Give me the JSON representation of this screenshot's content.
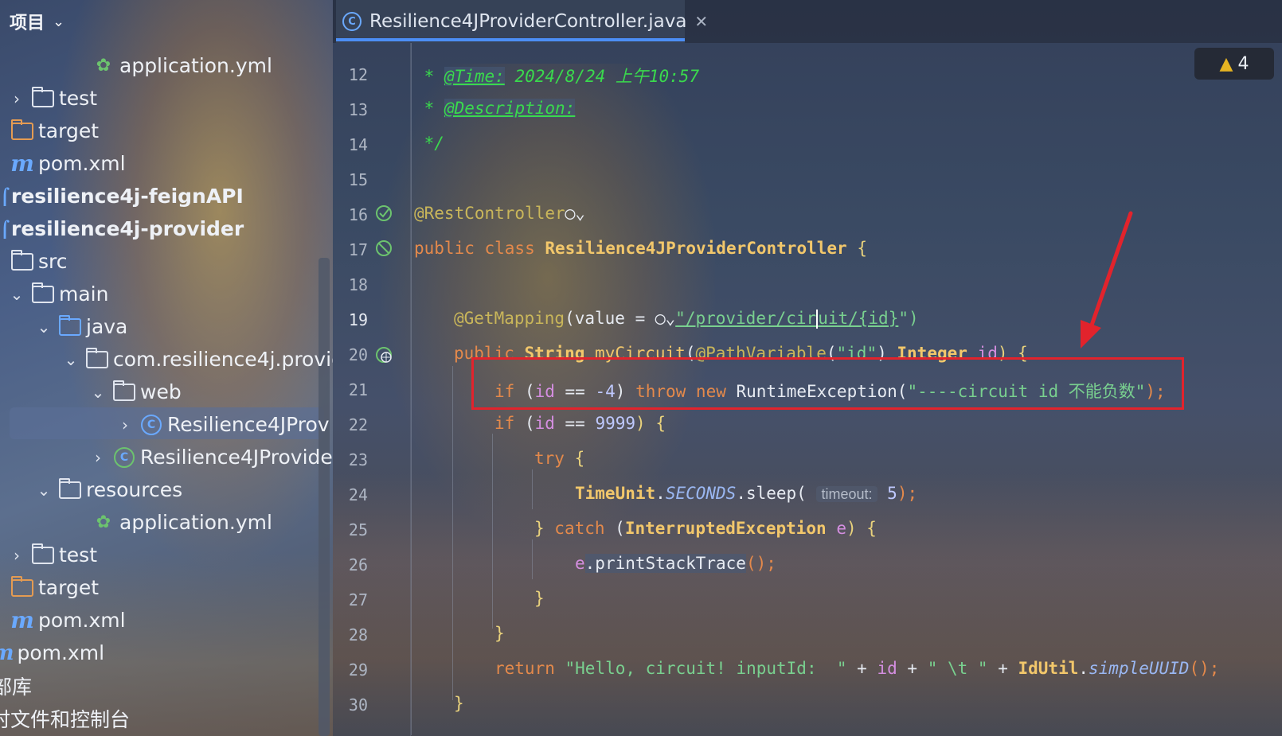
{
  "sidebar": {
    "title": "项目",
    "items": [
      {
        "label": "application.yml"
      },
      {
        "label": "test"
      },
      {
        "label": "target"
      },
      {
        "label": "pom.xml"
      },
      {
        "label": "resilience4j-feignAPI"
      },
      {
        "label": "resilience4j-provider"
      },
      {
        "label": "src"
      },
      {
        "label": "main"
      },
      {
        "label": "java"
      },
      {
        "label": "com.resilience4j.provic"
      },
      {
        "label": "web"
      },
      {
        "label": "Resilience4JProv"
      },
      {
        "label": "Resilience4JProvide"
      },
      {
        "label": "resources"
      },
      {
        "label": "application.yml"
      },
      {
        "label": "test"
      },
      {
        "label": "target"
      },
      {
        "label": "pom.xml"
      },
      {
        "label": "pom.xml"
      },
      {
        "label": "部库"
      },
      {
        "label": "时文件和控制台"
      }
    ]
  },
  "editor": {
    "tab_label": "Resilience4JProviderController.java",
    "warning_count": "4",
    "line_numbers": [
      "12",
      "13",
      "14",
      "15",
      "16",
      "17",
      "18",
      "19",
      "20",
      "21",
      "22",
      "23",
      "24",
      "25",
      "26",
      "27",
      "28",
      "29",
      "30"
    ],
    "code": {
      "l12_star": " * ",
      "l12_tag": "@Time:",
      "l12_val": " 2024/8/24 上午10:57",
      "l13_star": " * ",
      "l13_tag": "@Description:",
      "l14": " */",
      "l16_ann": "@RestController",
      "l17_kw": "public class ",
      "l17_cls": "Resilience4JProviderController",
      "l17_brace": " {",
      "l19_ann": "@GetMapping",
      "l19_a": "(value = ",
      "l19_str1": "\"/provider/cir",
      "l19_str2": "uit/{id}",
      "l19_end": "\")",
      "l20_kw": "public ",
      "l20_cls": "String ",
      "l20_m": "myCircuit",
      "l20_a": "(",
      "l20_ann": "@PathVariable",
      "l20_b": "(",
      "l20_str": "\"id\"",
      "l20_c": ") ",
      "l20_cls2": "Integer ",
      "l20_p": "id",
      "l20_d": ") {",
      "l21_kw": "if ",
      "l21_a": "(",
      "l21_p": "id",
      "l21_b": " == ",
      "l21_n": "-4",
      "l21_c": ") ",
      "l21_kw2": "throw new ",
      "l21_cls": "RuntimeException",
      "l21_d": "(",
      "l21_str": "\"----circuit id 不能负数\"",
      "l21_e": ");",
      "l22_kw": "if ",
      "l22_a": "(",
      "l22_p": "id",
      "l22_b": " == ",
      "l22_n": "9999",
      "l22_c": ") {",
      "l23_kw": "try ",
      "l23_b": "{",
      "l24_cls": "TimeUnit",
      "l24_dot": ".",
      "l24_it": "SECONDS",
      "l24_m": ".sleep( ",
      "l24_hint": "timeout:",
      "l24_n": " 5",
      "l24_end": ");",
      "l25_b": "} ",
      "l25_kw": "catch ",
      "l25_a": "(",
      "l25_cls": "InterruptedException ",
      "l25_p": "e",
      "l25_c": ") {",
      "l26_p": "e",
      "l26_m": ".printStackTrace",
      "l26_end": "();",
      "l27": "}",
      "l28": "}",
      "l29_kw": "return ",
      "l29_str": "\"Hello, circuit! inputId:  \"",
      "l29_a": " + ",
      "l29_p": "id",
      "l29_b": " + ",
      "l29_str2": "\" \\t \"",
      "l29_c": " + ",
      "l29_cls": "IdUtil",
      "l29_dot": ".",
      "l29_it": "simpleUUID",
      "l29_end": "();",
      "l30": "}"
    }
  },
  "colors": {
    "accent": "#4c8ef5",
    "highlight_box": "#e2232c",
    "arrow": "#e2232c",
    "warning": "#e6b422"
  }
}
